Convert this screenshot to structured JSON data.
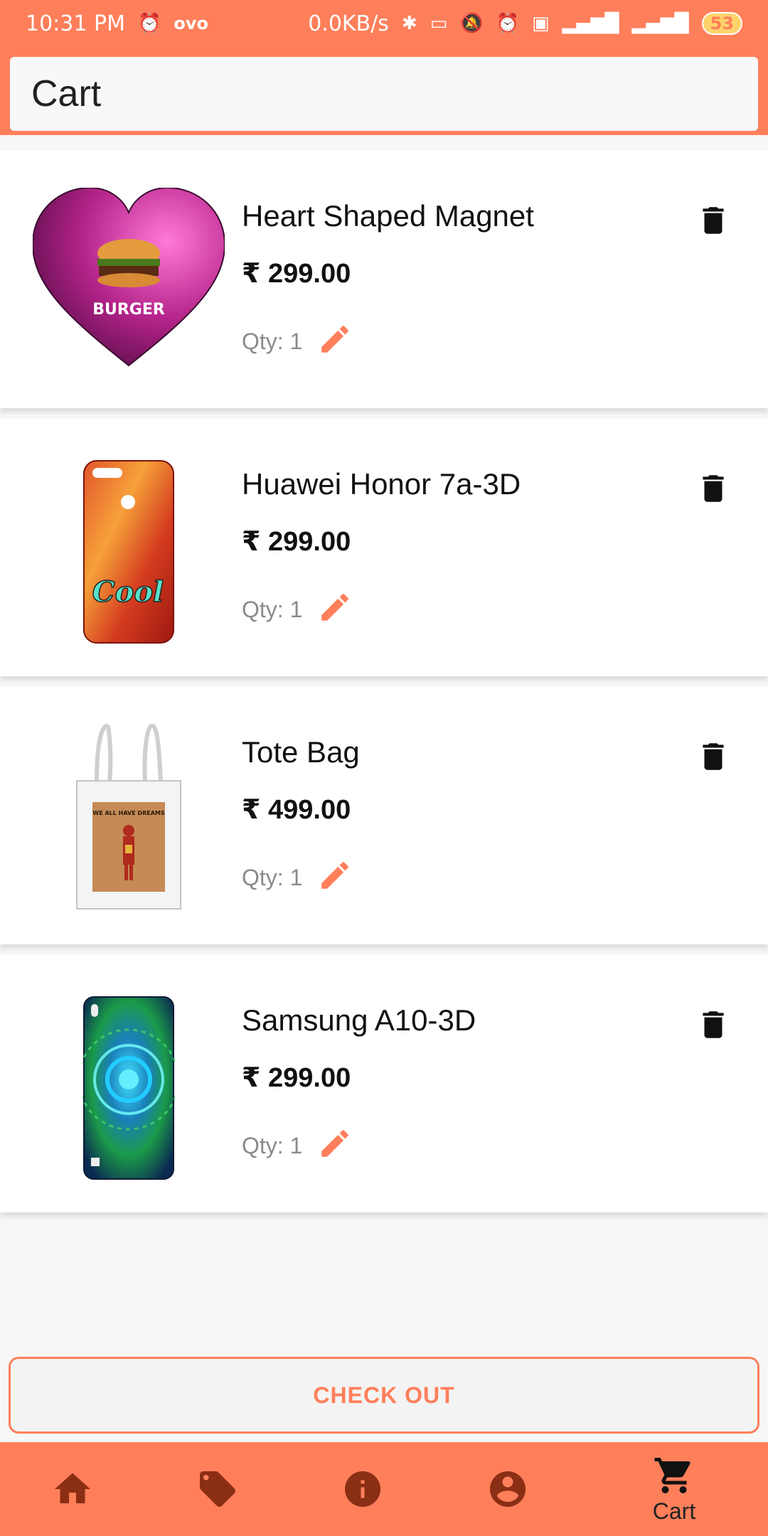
{
  "status_bar": {
    "time": "10:31 PM",
    "carrier": "ovo",
    "speed": "0.0KB/s",
    "battery": "53"
  },
  "header": {
    "title": "Cart"
  },
  "cart": {
    "items": [
      {
        "name": "Heart Shaped Magnet",
        "price": "₹ 299.00",
        "qty": "Qty: 1",
        "image_text": "BURGER"
      },
      {
        "name": "Huawei Honor 7a-3D",
        "price": "₹ 299.00",
        "qty": "Qty: 1",
        "image_text": "Cool"
      },
      {
        "name": "Tote Bag",
        "price": "₹ 499.00",
        "qty": "Qty: 1",
        "image_text": "WE ALL HAVE DREAMS"
      },
      {
        "name": "Samsung A10-3D",
        "price": "₹ 299.00",
        "qty": "Qty: 1"
      }
    ]
  },
  "checkout": {
    "label": "CHECK OUT"
  },
  "bottom_nav": {
    "items": [
      {
        "icon": "home-icon"
      },
      {
        "icon": "tag-icon"
      },
      {
        "icon": "info-icon"
      },
      {
        "icon": "account-icon"
      },
      {
        "icon": "cart-icon",
        "label": "Cart",
        "active": true
      }
    ]
  },
  "colors": {
    "accent": "#ff7f5b",
    "background": "#f7f7f7",
    "card": "#ffffff"
  }
}
